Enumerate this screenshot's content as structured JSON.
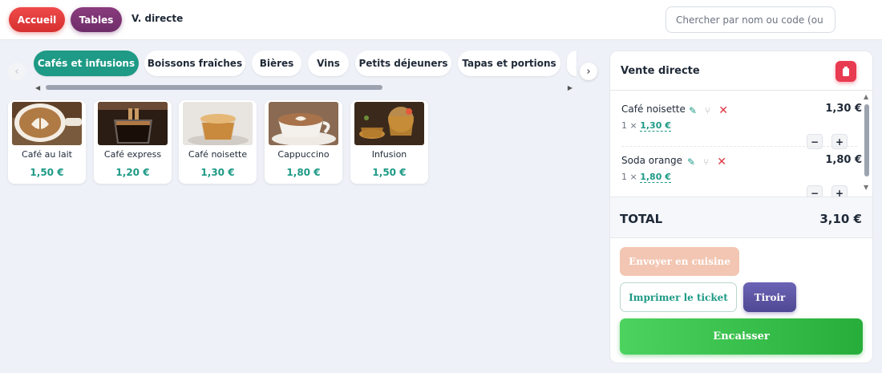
{
  "topbar": {
    "home_label": "Accueil",
    "tables_label": "Tables",
    "mode_label": "V. directe",
    "search_placeholder": "Chercher par nom ou code (ou"
  },
  "categories": [
    {
      "label": "Cafés et infusions",
      "active": true
    },
    {
      "label": "Boissons fraîches",
      "active": false
    },
    {
      "label": "Bières",
      "active": false
    },
    {
      "label": "Vins",
      "active": false
    },
    {
      "label": "Petits déjeuners",
      "active": false
    },
    {
      "label": "Tapas et portions",
      "active": false
    }
  ],
  "products": [
    {
      "name": "Café au lait",
      "price": "1,50 €"
    },
    {
      "name": "Café express",
      "price": "1,20 €"
    },
    {
      "name": "Café noisette",
      "price": "1,30 €"
    },
    {
      "name": "Cappuccino",
      "price": "1,80 €"
    },
    {
      "name": "Infusion",
      "price": "1,50 €"
    }
  ],
  "order": {
    "title": "Vente directe",
    "lines": [
      {
        "name": "Café noisette",
        "qty_prefix": "1 ×",
        "unit_price": "1,30 €",
        "line_total": "1,30 €",
        "minus": "−",
        "plus": "+"
      },
      {
        "name": "Soda orange",
        "qty_prefix": "1 ×",
        "unit_price": "1,80 €",
        "line_total": "1,80 €",
        "minus": "−",
        "plus": "+"
      }
    ],
    "total_label": "TOTAL",
    "total_value": "3,10 €"
  },
  "actions": {
    "send_kitchen": "Envoyer en cuisine",
    "print_ticket": "Imprimer le ticket",
    "drawer": "Tiroir",
    "checkout": "Encaisser"
  },
  "colors": {
    "accent": "#1e9a86",
    "home": "#e23b3b",
    "tables": "#7b3372",
    "trash": "#e83a50",
    "checkout": "#34c04a",
    "drawer": "#5b54a4"
  }
}
